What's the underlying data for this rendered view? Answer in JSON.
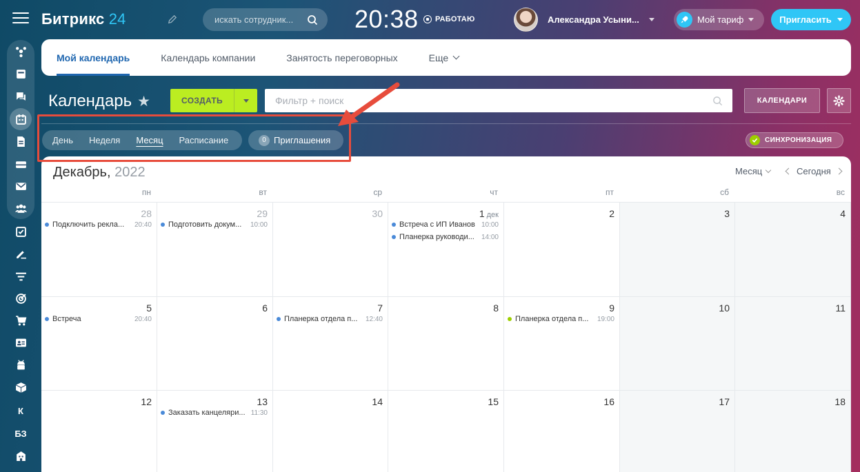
{
  "brand": {
    "name": "Битрикс",
    "num": "24"
  },
  "search": {
    "placeholder": "искать сотрудник..."
  },
  "clock": {
    "time": "20:38",
    "status": "РАБОТАЮ"
  },
  "user": {
    "name": "Александра Усыни..."
  },
  "header": {
    "tariff_label": "Мой тариф",
    "invite_label": "Пригласить"
  },
  "sidebar": {
    "icons": [
      "network-icon",
      "news-icon",
      "chat-icon",
      "calendar-icon",
      "document-icon",
      "drive-icon",
      "mail-icon",
      "group-icon",
      "tasks-icon",
      "sign-icon",
      "crm-icon",
      "target-icon",
      "shop-icon",
      "contact-icon",
      "android-icon",
      "box-icon"
    ],
    "text_items": [
      "К",
      "БЗ"
    ]
  },
  "tabs": [
    {
      "label": "Мой календарь",
      "active": true
    },
    {
      "label": "Календарь компании"
    },
    {
      "label": "Занятость переговорных"
    },
    {
      "label": "Еще"
    }
  ],
  "toolbar": {
    "title": "Календарь",
    "create_label": "СОЗДАТЬ",
    "filter_placeholder": "Фильтр + поиск",
    "calendars_label": "КАЛЕНДАРИ"
  },
  "views": [
    {
      "label": "День"
    },
    {
      "label": "Неделя"
    },
    {
      "label": "Месяц",
      "active": true
    },
    {
      "label": "Расписание"
    }
  ],
  "invitations": {
    "count": "0",
    "label": "Приглашения"
  },
  "sync": {
    "label": "СИНХРОНИЗАЦИЯ"
  },
  "calendar": {
    "month": "Декабрь,",
    "year": "2022",
    "view_select": "Месяц",
    "today_label": "Сегодня",
    "weekdays": [
      "пн",
      "вт",
      "ср",
      "чт",
      "пт",
      "сб",
      "вс"
    ],
    "colors": {
      "blue": "#4a8ad8",
      "green": "#9dcf00"
    },
    "weeks": [
      [
        {
          "day": "28",
          "other": true,
          "events": [
            {
              "title": "Подключить рекла...",
              "time": "20:40",
              "color": "#4a8ad8"
            }
          ]
        },
        {
          "day": "29",
          "other": true,
          "events": [
            {
              "title": "Подготовить докум...",
              "time": "10:00",
              "color": "#4a8ad8"
            }
          ]
        },
        {
          "day": "30",
          "other": true,
          "events": []
        },
        {
          "day": "1",
          "suffix": "дек",
          "events": [
            {
              "title": "Встреча с ИП Иванов",
              "time": "10:00",
              "color": "#4a8ad8"
            },
            {
              "title": "Планерка руководи...",
              "time": "14:00",
              "color": "#4a8ad8"
            }
          ]
        },
        {
          "day": "2",
          "events": []
        },
        {
          "day": "3",
          "weekend": true,
          "events": []
        },
        {
          "day": "4",
          "weekend": true,
          "events": []
        }
      ],
      [
        {
          "day": "5",
          "events": [
            {
              "title": "Встреча",
              "time": "20:40",
              "color": "#4a8ad8"
            }
          ]
        },
        {
          "day": "6",
          "events": []
        },
        {
          "day": "7",
          "events": [
            {
              "title": "Планерка отдела п...",
              "time": "12:40",
              "color": "#4a8ad8"
            }
          ]
        },
        {
          "day": "8",
          "events": []
        },
        {
          "day": "9",
          "events": [
            {
              "title": "Планерка отдела п...",
              "time": "19:00",
              "color": "#9dcf00"
            }
          ]
        },
        {
          "day": "10",
          "weekend": true,
          "events": []
        },
        {
          "day": "11",
          "weekend": true,
          "events": []
        }
      ],
      [
        {
          "day": "12",
          "events": []
        },
        {
          "day": "13",
          "events": [
            {
              "title": "Заказать канцеляри...",
              "time": "11:30",
              "color": "#4a8ad8"
            }
          ]
        },
        {
          "day": "14",
          "events": []
        },
        {
          "day": "15",
          "events": []
        },
        {
          "day": "16",
          "events": []
        },
        {
          "day": "17",
          "weekend": true,
          "events": []
        },
        {
          "day": "18",
          "weekend": true,
          "events": []
        }
      ]
    ]
  }
}
